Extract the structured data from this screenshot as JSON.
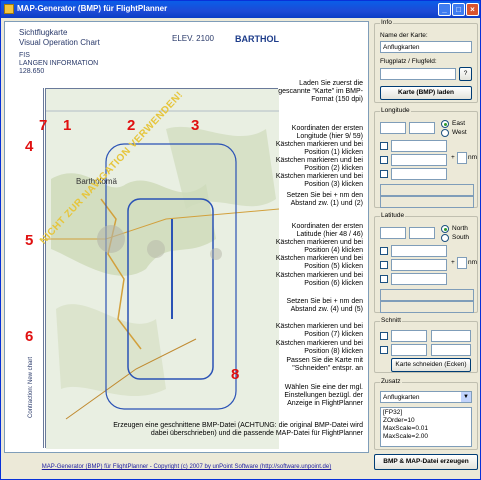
{
  "window": {
    "title": "MAP-Generator (BMP) für FlightPlanner"
  },
  "map": {
    "header": {
      "line1": "Sichtflugkarte",
      "line2": "Visual Operation Chart",
      "elev": "ELEV. 2100",
      "place": "BARTHOL",
      "fis": "FIS",
      "lang": "LANGEN INFORMATION",
      "freq": "128.650"
    },
    "labels": {
      "l1": "1",
      "l2": "2",
      "l3": "3",
      "l4": "4",
      "l5": "5",
      "l6": "6",
      "l7": "7",
      "l8": "8"
    },
    "watermark": "NICHT ZUR NAVIGATION VERWENDEN!",
    "town": "Bartholomä",
    "contraction": "Contraction: New chart"
  },
  "instructions": {
    "a1": "Laden Sie zuerst die gescannte \"Karte\" im BMP-Format (150 dpi)",
    "a2": "Koordinaten der ersten Longitude (hier 9/ 59) Kästchen markieren und bei Position (1) klicken",
    "a3": "Kästchen markieren und bei Position (2) klicken",
    "a4": "Kästchen markieren und bei Position (3) klicken",
    "a5": "Setzen Sie bei + nm den Abstand zw. (1) und (2)",
    "a6": "Koordinaten der ersten Latitude (hier 48 / 46) Kästchen markieren und bei Position (4) klicken",
    "a7": "Kästchen markieren und bei Position (5) klicken",
    "a8": "Kästchen markieren und bei Position (6) klicken",
    "a9": "Setzen Sie bei + nm den Abstand zw. (4) und (5)",
    "a10": "Kästchen markieren und bei Position (7) klicken",
    "a11": "Kästchen markieren und bei Position (8) klicken",
    "a12": "Passen Sie die Karte mit \"Schneiden\" entspr. an",
    "a13": "Wählen Sie eine der mgl. Einstellungen bezügl. der Anzeige in FlightPlanner",
    "a14": "Erzeugen eine geschnittene BMP-Datei (ACHTUNG: die original BMP-Datei wird dabei überschrieben) und die passende MAP-Datei für FlightPlanner"
  },
  "panel": {
    "info_title": "Info",
    "name_label": "Name der Karte:",
    "name_value": "Anflugkarten",
    "airfield_label": "Flugplatz / Flugfeld:",
    "airfield_btn": "?",
    "load_btn": "Karte (BMP) laden",
    "longitude_title": "Longitude",
    "east": "East",
    "west": "West",
    "latitude_title": "Latitude",
    "north": "North",
    "south": "South",
    "plus": "+",
    "nm": "nm",
    "schnitt_title": "Schnitt",
    "cut_btn": "Karte schneiden (Ecken)",
    "zusatz_title": "Zusatz",
    "zusatz_select": "Anflugkarten",
    "memo": [
      "[FP32]",
      "ZOrder=10",
      "MaxScale=0.01",
      "MaxScale=2.00"
    ],
    "generate_btn": "BMP & MAP-Datei erzeugen"
  },
  "footer": "MAP-Generator (BMP) für FlightPlanner - Copyright (c) 2007 by unPoint Software (http://software.unpoint.de)"
}
